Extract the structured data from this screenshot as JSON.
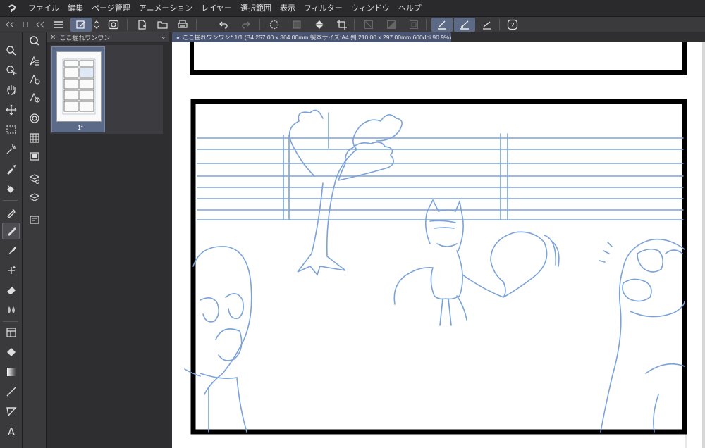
{
  "menubar": {
    "items": [
      "ファイル",
      "編集",
      "ページ管理",
      "アニメーション",
      "レイヤー",
      "選択範囲",
      "表示",
      "フィルター",
      "ウィンドウ",
      "ヘルプ"
    ]
  },
  "command_bar": {
    "buttons": [
      "menu-icon",
      "page-manager-icon",
      "sort-icon",
      "layer-view-icon",
      "new-page-icon",
      "open-icon",
      "print-icon",
      "undo-icon",
      "redo-icon",
      "rotate-icon",
      "fill-transform-icon",
      "fill-icon",
      "crop-icon",
      "clear-outside-icon",
      "fill-selection-icon",
      "frame-icon",
      "pen-settings-icon",
      "brush-settings-icon",
      "ruler-snap-icon",
      "help-icon"
    ]
  },
  "page_panel": {
    "tab_title": "ここ掘れワンワン",
    "page_label": "1*"
  },
  "document_tab": {
    "title": "ここ掘れワンワン* 1/1 (B4 257.00 x 364.00mm 製本サイズ:A4 判 210.00 x 297.00mm 600dpi 90.9%)"
  },
  "colors": {
    "accent": "#5d6a86",
    "sketch_line": "#7ba3d9",
    "frame_border": "#000000"
  }
}
